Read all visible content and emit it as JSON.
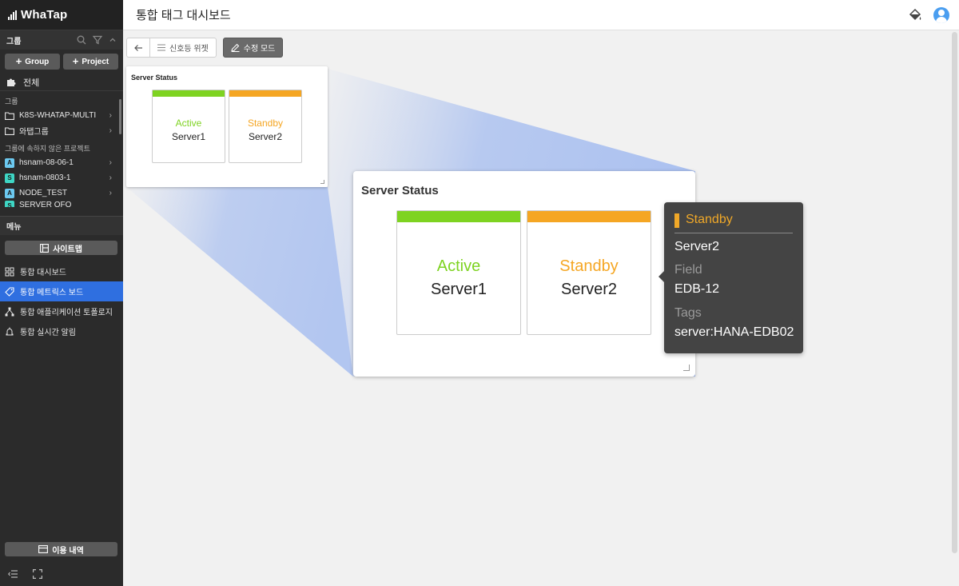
{
  "app": {
    "logo_text": "WhaTap",
    "page_title": "통합 태그 대시보드"
  },
  "sidebar": {
    "group_header": "그룹",
    "add_group": "Group",
    "add_project": "Project",
    "whole_label": "전체",
    "groups_label": "그룹",
    "groups": [
      {
        "label": "K8S-WHATAP-MULTI"
      },
      {
        "label": "와탭그룹"
      }
    ],
    "ungrouped_label": "그룹에 속하지 않은 프로젝트",
    "projects": [
      {
        "badge": "A",
        "label": "hsnam-08-06-1"
      },
      {
        "badge": "S",
        "label": "hsnam-0803-1"
      },
      {
        "badge": "A",
        "label": "NODE_TEST"
      },
      {
        "badge": "S",
        "label": "SERVER OFO"
      }
    ],
    "menu_header": "메뉴",
    "sitemap_button": "사이트맵",
    "menu_items": [
      {
        "label": "통합 대시보드",
        "active": false
      },
      {
        "label": "통합 메트릭스 보드",
        "active": true
      },
      {
        "label": "통합 애플리케이션 토폴로지",
        "active": false
      },
      {
        "label": "통합 실시간 알림",
        "active": false
      }
    ],
    "usage_button": "이용 내역"
  },
  "toolbar": {
    "signal_widget": "신호등 위젯",
    "edit_mode": "수정 모드"
  },
  "widget": {
    "title": "Server Status",
    "cards": [
      {
        "state": "Active",
        "name": "Server1",
        "color": "#7ed321"
      },
      {
        "state": "Standby",
        "name": "Server2",
        "color": "#f5a623"
      }
    ]
  },
  "tooltip": {
    "state": "Standby",
    "name": "Server2",
    "field_label": "Field",
    "field_value": "EDB-12",
    "tags_label": "Tags",
    "tags_value": "server:HANA-EDB02"
  },
  "colors": {
    "active": "#7ed321",
    "standby": "#f5a623",
    "menu_active": "#2f6fe0"
  }
}
